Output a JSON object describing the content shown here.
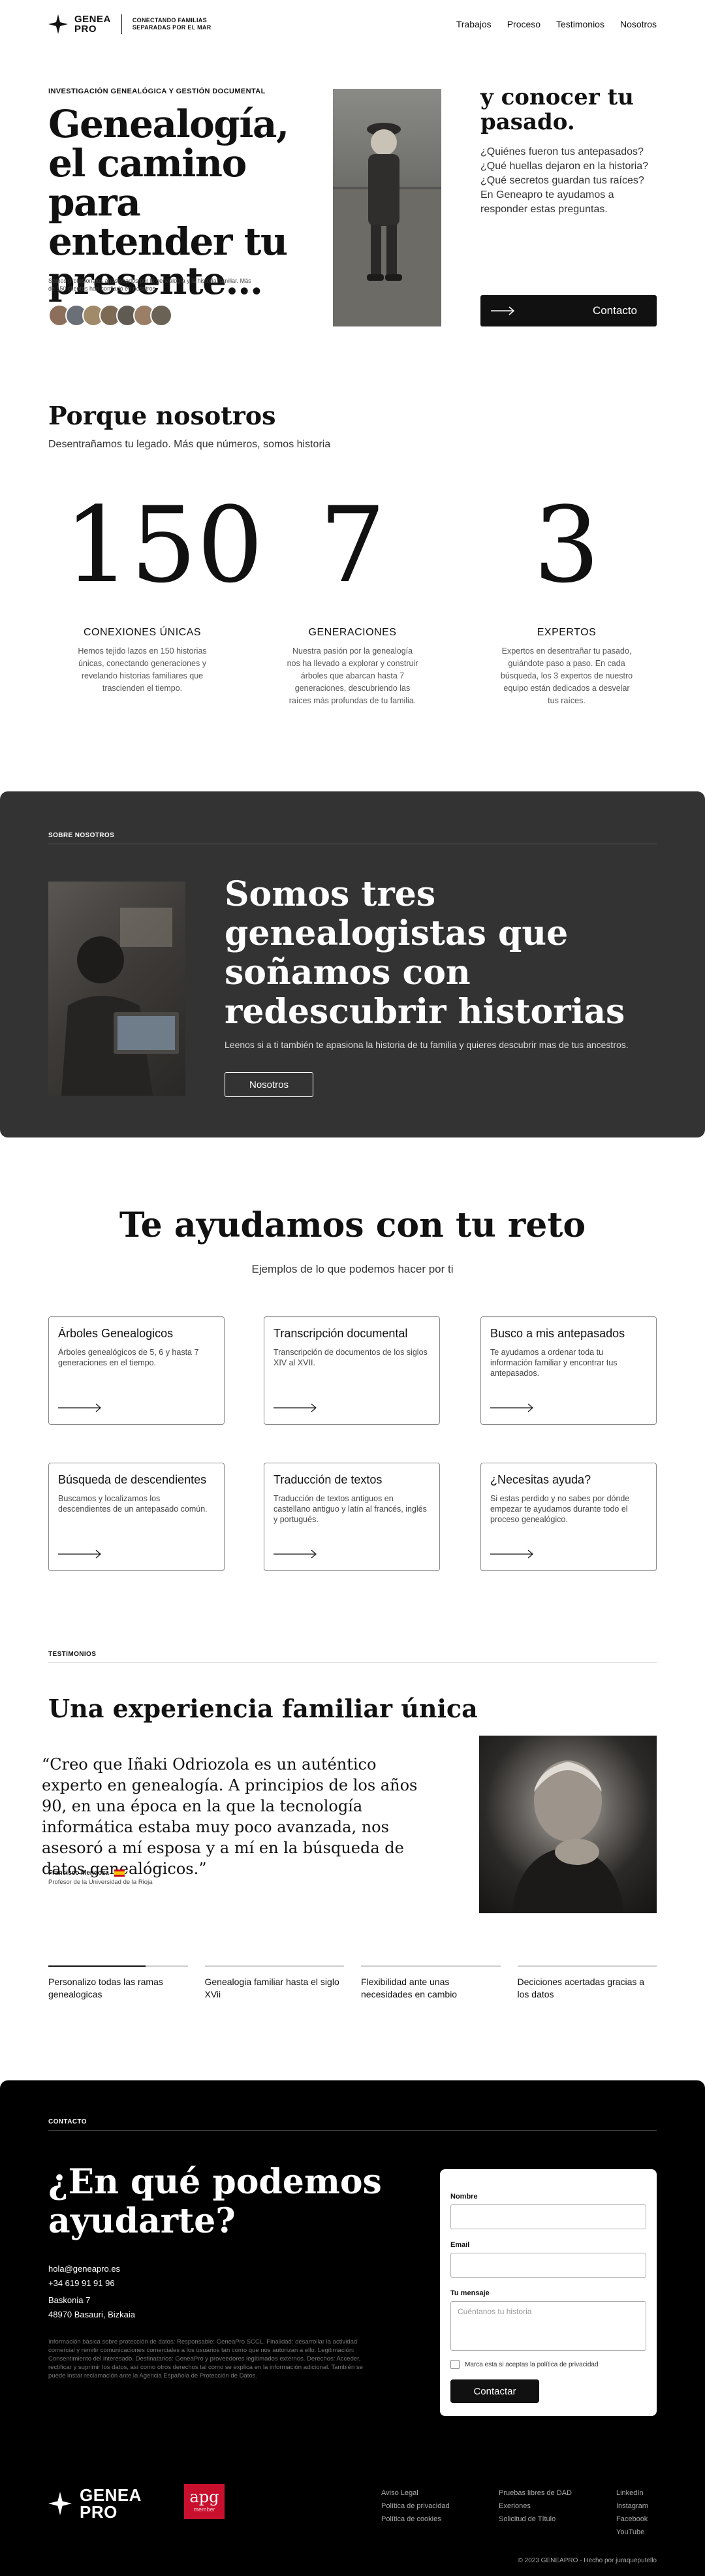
{
  "header": {
    "logo_line1": "GENEA",
    "logo_line2": "PRO",
    "tagline": "CONECTANDO FAMILIAS SEPARADAS POR EL MAR",
    "nav": [
      "Trabajos",
      "Proceso",
      "Testimonios",
      "Nosotros"
    ]
  },
  "hero": {
    "eyebrow": "INVESTIGACIÓN GENEALÓGICA Y GESTIÓN DOCUMENTAL",
    "title": "Genealogía, el camino para entender tu presente...",
    "subtitle": "Somos profesionales apasionados por la genealogía y la historia familiar. Más de 150 clientes han confiado en nosotros.",
    "side_title": "y conocer tu pasado.",
    "side_text": "¿Quiénes fueron tus antepasados? ¿Qué huellas dejaron en la historia? ¿Qué secretos guardan tus raíces? En Geneapro te ayudamos a responder estas preguntas.",
    "cta": "Contacto"
  },
  "why": {
    "title": "Porque nosotros",
    "subtitle": "Desentrañamos tu legado. Más que números, somos historia",
    "stats": [
      {
        "num": "150",
        "label": "CONEXIONES ÚNICAS",
        "desc": "Hemos tejido lazos en 150 historias únicas, conectando generaciones y revelando historias familiares que trascienden el tiempo."
      },
      {
        "num": "7",
        "label": "GENERACIONES",
        "desc": "Nuestra pasión por la genealogía nos ha llevado a explorar y construir árboles que abarcan hasta 7 generaciones, descubriendo las raíces más profundas de tu familia."
      },
      {
        "num": "3",
        "label": "EXPERTOS",
        "desc": "Expertos en desentrañar tu pasado, guiándote paso a paso. En cada búsqueda, los 3 expertos de nuestro equipo están dedicados a desvelar tus raíces."
      }
    ]
  },
  "about": {
    "eyebrow": "SOBRE NOSOTROS",
    "title": "Somos tres genealogistas que soñamos con redescubrir historias",
    "text": "Leenos si a ti también te apasiona la historia de tu familia y quieres descubrir mas de tus ancestros.",
    "button": "Nosotros"
  },
  "services": {
    "title": "Te ayudamos con tu reto",
    "subtitle": "Ejemplos de lo que podemos hacer por ti",
    "cards": [
      {
        "title": "Árboles Genealogicos",
        "desc": "Árboles genealógicos de 5, 6 y hasta 7 generaciones en el tiempo."
      },
      {
        "title": "Transcripción documental",
        "desc": "Transcripción de documentos de los siglos XIV al XVII."
      },
      {
        "title": "Busco a mis antepasados",
        "desc": "Te ayudamos a ordenar toda tu información familiar y encontrar tus antepasados."
      },
      {
        "title": "Búsqueda de descendientes",
        "desc": "Buscamos y localizamos los descendientes de un antepasado común."
      },
      {
        "title": "Traducción de textos",
        "desc": "Traducción de textos antiguos en castellano antiguo y latín al francés, inglés y portugués."
      },
      {
        "title": "¿Necesitas ayuda?",
        "desc": "Si estas perdido y no sabes por dónde empezar te ayudamos durante todo el proceso genealógico."
      }
    ]
  },
  "testimonials": {
    "eyebrow": "TESTIMONIOS",
    "title": "Una experiencia familiar única",
    "quote": "“Creo que Iñaki Odriozola es un auténtico experto en genealogía. A principios de los años 90, en una época en la que la tecnología informática estaba muy poco avanzada, nos asesoró a mí esposa y a mí en la búsqueda de datos genealógicos.”",
    "name": "Francisco Mendoza",
    "role": "Profesor de la Universidad de la Rioja",
    "tabs": [
      "Personalizo todas las ramas genealogicas",
      "Genealogia familiar hasta el siglo XVii",
      "Flexibilidad ante unas necesidades en cambio",
      "Deciciones acertadas gracias a los datos"
    ],
    "active_tab": 0
  },
  "contact": {
    "eyebrow": "CONTACTO",
    "title": "¿En qué podemos ayudarte?",
    "email": "hola@geneapro.es",
    "phone": "+34 619 91 91 96",
    "address1": "Baskonia 7",
    "address2": "48970 Basauri, Bizkaia",
    "legal": "Información básica sobre protección de datos: Responsable: GeneaPro SCCL. Finalidad: desarrollar la actividad comercial y remitir comunicaciones comerciales a los usuarios tan como que nos autorizan a ello. Legitimación: Consentimiento del interesado. Destinatarios: GeneaPro y proveedores legítimados externos. Derechos: Acceder, rectificar y suprimir los datos, así como otros derechos tal como se explica en la información adicional. También se puede instar reclamación ante la Agencia Española de Protección de Datos.",
    "form": {
      "name_label": "Nombre",
      "email_label": "Email",
      "message_label": "Tu mensaje",
      "message_placeholder": "Cuéntanos tu historia",
      "privacy": "Marca esta si aceptas la política de privacidad",
      "submit": "Contactar"
    }
  },
  "footer": {
    "logo_line1": "GENEA",
    "logo_line2": "PRO",
    "apg": "apg",
    "apg_sub": "member",
    "col1": [
      "Aviso Legal",
      "Política de privacidad",
      "Política de cookies"
    ],
    "col2": [
      "Pruebas libres de DAD",
      "Exeriones",
      "Solicitud de Título"
    ],
    "col3": [
      "LinkedIn",
      "Instagram",
      "Facebook",
      "YouTube"
    ],
    "copyright": "© 2023 GENEAPRO - Hecho por juraqueputello"
  }
}
